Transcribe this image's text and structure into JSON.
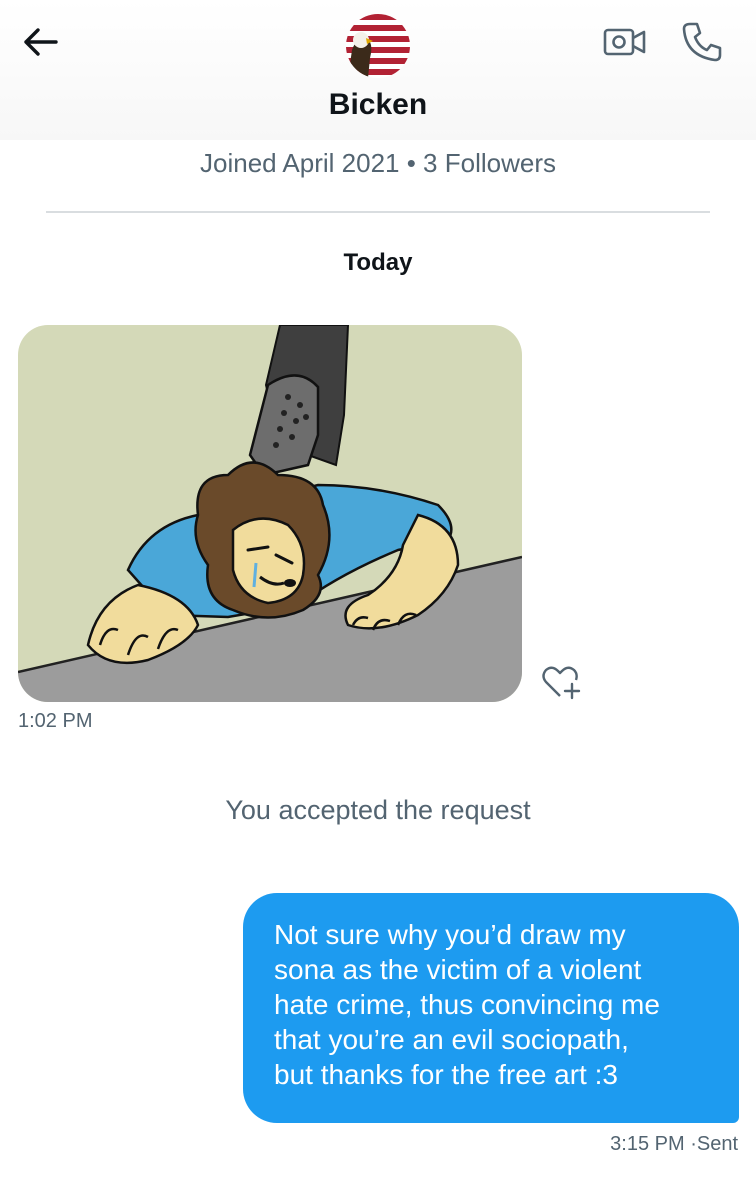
{
  "header": {
    "contact_name": "Bicken",
    "back_icon": "arrow-left-icon",
    "video_icon": "video-camera-icon",
    "call_icon": "phone-icon",
    "avatar": "flag-eagle-avatar"
  },
  "profile": {
    "meta": "Joined April 2021 • 3 Followers"
  },
  "conversation": {
    "day_label": "Today",
    "incoming": {
      "attachment": "drawing-image",
      "time": "1:02 PM",
      "react_icon": "heart-plus-icon"
    },
    "system_note": "You accepted the request",
    "outgoing": {
      "lines": [
        "Not sure why you’d draw my",
        "sona as the victim of a violent",
        "hate crime, thus convincing me",
        "that you’re an evil sociopath,",
        "but thanks for the free art :3"
      ],
      "status": "3:15 PM ·Sent"
    }
  },
  "colors": {
    "accent": "#1d9bf0",
    "secondary_text": "#536471",
    "primary_text": "#0f1419",
    "divider": "#d9dde0"
  }
}
